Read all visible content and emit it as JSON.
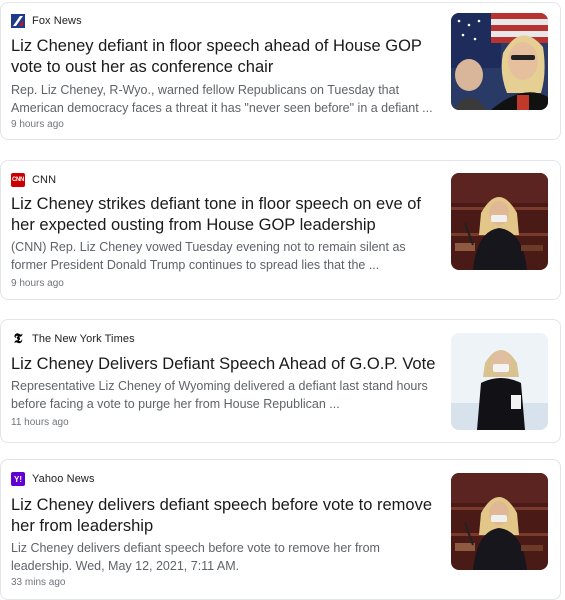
{
  "articles": [
    {
      "source": "Fox News",
      "logo_icon": "fox-news-logo-icon",
      "logo_color": "#1e3a8a",
      "headline": "Liz Cheney defiant in floor speech ahead of House GOP vote to oust her as conference chair",
      "snippet_line1": "Rep. Liz Cheney, R-Wyo., warned fellow Republicans on Tuesday that",
      "snippet_line2": "American democracy faces a threat it has \"never seen before\" in a defiant ...",
      "time": "9 hours ago"
    },
    {
      "source": "CNN",
      "logo_icon": "cnn-logo-icon",
      "logo_text": "CNN",
      "logo_color": "#cc0000",
      "headline": "Liz Cheney strikes defiant tone in floor speech on eve of her expected ousting from House GOP leadership",
      "snippet_line1": "(CNN) Rep. Liz Cheney vowed Tuesday evening not to remain silent as",
      "snippet_line2": "former President Donald Trump continues to spread lies that the ...",
      "time": "9 hours ago"
    },
    {
      "source": "The New York Times",
      "logo_icon": "nyt-logo-icon",
      "logo_text": "𝕿",
      "headline": "Liz Cheney Delivers Defiant Speech Ahead of G.O.P. Vote",
      "snippet_line1": "Representative Liz Cheney of Wyoming delivered a defiant last stand hours",
      "snippet_line2": "before facing a vote to purge her from House Republican ...",
      "time": "11 hours ago"
    },
    {
      "source": "Yahoo News",
      "logo_icon": "yahoo-logo-icon",
      "logo_text": "Y!",
      "logo_color": "#6001d2",
      "headline": "Liz Cheney delivers defiant speech before vote to remove her from leadership",
      "snippet_line1": "Liz Cheney delivers defiant speech before vote to remove her from",
      "snippet_line2": "leadership. Wed, May 12, 2021, 7:11 AM.",
      "time": "33 mins ago"
    }
  ]
}
